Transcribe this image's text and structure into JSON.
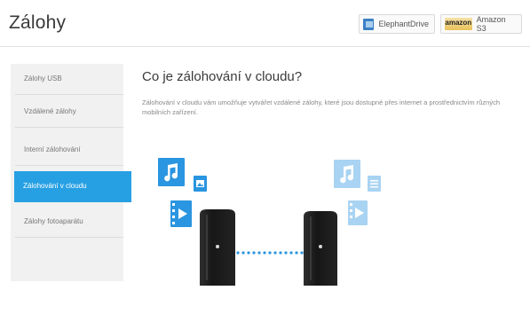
{
  "header": {
    "title": "Zálohy",
    "providers": [
      {
        "label": "ElephantDrive"
      },
      {
        "label": "Amazon S3",
        "logo_text": "amazon"
      }
    ]
  },
  "sidebar": {
    "items": [
      {
        "label": "Zálohy USB"
      },
      {
        "label": "Vzdálené zálohy"
      },
      {
        "label": "Interní zálohování"
      },
      {
        "label": "Zálohování v cloudu",
        "active": true
      },
      {
        "label": "Zálohy fotoaparátu"
      }
    ]
  },
  "main": {
    "title": "Co je zálohování v cloudu?",
    "description": "Zálohování v cloudu vám umožňuje vytvářet vzdálené zálohy, které jsou dostupné přes internet a prostřednictvím různých mobilních zařízení."
  },
  "colors": {
    "accent": "#27a0e3",
    "icon_strong": "#2a95e0",
    "icon_faded": "#a9d3f2",
    "drive": "#1c1c1c"
  },
  "illustration": {
    "icons": [
      "music-icon",
      "photo-icon",
      "video-icon",
      "music-icon-faded",
      "document-icon-faded",
      "video-icon-faded"
    ]
  }
}
